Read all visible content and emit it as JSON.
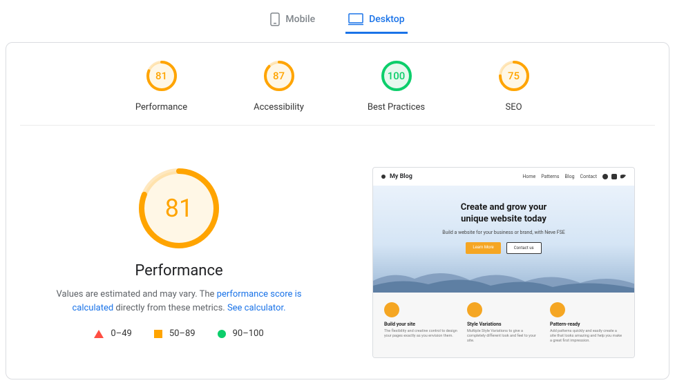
{
  "tabs": {
    "mobile": "Mobile",
    "desktop": "Desktop"
  },
  "gauges": [
    {
      "label": "Performance",
      "score": 81,
      "color": "#ffa400",
      "bg": "#fff7e6"
    },
    {
      "label": "Accessibility",
      "score": 87,
      "color": "#ffa400",
      "bg": "#fff7e6"
    },
    {
      "label": "Best Practices",
      "score": 100,
      "color": "#0cce6b",
      "bg": "#e6f8ee"
    },
    {
      "label": "SEO",
      "score": 75,
      "color": "#ffa400",
      "bg": "#fff7e6"
    }
  ],
  "main": {
    "score": 81,
    "color": "#ffa400",
    "bg": "#fff7e6",
    "title": "Performance",
    "desc_prefix": "Values are estimated and may vary. The ",
    "link1": "performance score is calculated",
    "desc_mid": " directly from these metrics. ",
    "link2": "See calculator.",
    "legend": {
      "red": "0–49",
      "orange": "50–89",
      "green": "90–100"
    }
  },
  "preview": {
    "site_name": "My Blog",
    "nav": [
      "Home",
      "Patterns",
      "Blog",
      "Contact"
    ],
    "hero_title_1": "Create and grow your",
    "hero_title_2": "unique website today",
    "hero_sub": "Build a website for your business or brand, with Neve FSE",
    "btn1": "Learn More",
    "btn2": "Contact us",
    "features": [
      {
        "title": "Build your site",
        "desc": "The flexibility and creative control to design your pages exactly as you envision them."
      },
      {
        "title": "Style Variations",
        "desc": "Multiple Style Variations to give a completely different look and feel to your site."
      },
      {
        "title": "Pattern-ready",
        "desc": "Add patterns quickly and easily create a site that looks amazing and help you make a great first impression."
      }
    ]
  }
}
